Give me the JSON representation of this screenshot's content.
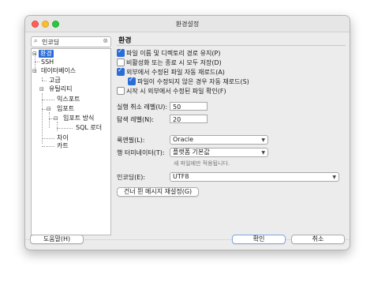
{
  "window": {
    "title": "환경설정"
  },
  "search": {
    "value": "인코딩"
  },
  "tree": {
    "items": [
      {
        "label": "환경",
        "selected": true
      },
      {
        "label": "SSH"
      },
      {
        "label": "데이터베이스"
      },
      {
        "label": "고급"
      },
      {
        "label": "유틸리티"
      },
      {
        "label": "익스포트"
      },
      {
        "label": "임포트"
      },
      {
        "label": "임포트 방식"
      },
      {
        "label": "SQL 로더"
      },
      {
        "label": "차이"
      },
      {
        "label": "카트"
      }
    ]
  },
  "panel": {
    "heading": "환경",
    "options": [
      {
        "label": "파일 이름 및 디렉토리 경로 유지(P)",
        "checked": true
      },
      {
        "label": "비활성화 또는 종료 시 모두 저장(D)",
        "checked": false
      },
      {
        "label": "외부에서 수정된 파일 자동 재로드(A)",
        "checked": true
      },
      {
        "label": "파일이 수정되지 않은 경우 자동 재로드(S)",
        "checked": true
      },
      {
        "label": "시작 시 외부에서 수정된 파일 확인(F)",
        "checked": false
      }
    ],
    "undo_label": "실행 취소 레벨(U):",
    "undo_value": "50",
    "nav_label": "탐색 레벨(N):",
    "nav_value": "20",
    "lookfeel_label": "룩앤필(L):",
    "lookfeel_value": "Oracle",
    "terminator_label": "행 터미네이터(T):",
    "terminator_value": "플랫폼 기본값",
    "terminator_note": "새 파일에만 적용됩니다.",
    "encoding_label": "인코딩(E):",
    "encoding_value": "UTF8",
    "reset_button": "건너 뛴 메시지 재설정(G)"
  },
  "footer": {
    "help": "도움말(H)",
    "ok": "확인",
    "cancel": "취소"
  }
}
